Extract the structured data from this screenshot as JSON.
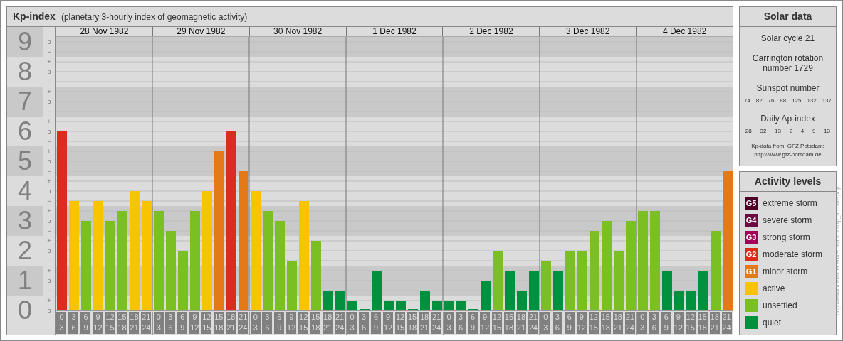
{
  "chart": {
    "title": "Kp-index",
    "subtitle": "(planetary 3-hourly index of geomagnetic activity)",
    "days": [
      "28 Nov 1982",
      "29 Nov 1982",
      "30 Nov 1982",
      "1 Dec 1982",
      "2 Dec 1982",
      "3 Dec 1982",
      "4 Dec 1982"
    ],
    "kp_marks": [
      "o",
      "−",
      "+",
      "o",
      "−",
      "+",
      "o",
      "−",
      "+",
      "o",
      "−",
      "+",
      "o",
      "−",
      "+",
      "o",
      "−",
      "+",
      "o",
      "−",
      "+",
      "o",
      "−",
      "+",
      "o",
      "−",
      "+",
      "o"
    ],
    "chart_data": {
      "type": "bar",
      "ylim": [
        0,
        9
      ],
      "yticks": [
        0,
        1,
        2,
        3,
        4,
        5,
        6,
        7,
        8,
        9
      ],
      "grid": true,
      "bands": [
        {
          "axis": "y",
          "from": 0.5,
          "to": 1.5
        },
        {
          "axis": "y",
          "from": 2.5,
          "to": 3.5
        },
        {
          "axis": "y",
          "from": 4.5,
          "to": 5.5
        },
        {
          "axis": "y",
          "from": 6.5,
          "to": 7.5
        },
        {
          "axis": "y",
          "from": 8.5,
          "to": 9.17
        }
      ],
      "categories": [
        "0\n3",
        "3\n6",
        "6\n9",
        "9\n12",
        "12\n15",
        "15\n18",
        "18\n21",
        "21\n24",
        "0\n3",
        "3\n6",
        "6\n9",
        "9\n12",
        "12\n15",
        "15\n18",
        "18\n21",
        "21\n24",
        "0\n3",
        "3\n6",
        "6\n9",
        "9\n12",
        "12\n15",
        "15\n18",
        "18\n21",
        "21\n24",
        "0\n3",
        "3\n6",
        "6\n9",
        "9\n12",
        "12\n15",
        "15\n18",
        "18\n21",
        "21\n24",
        "0\n3",
        "3\n6",
        "6\n9",
        "9\n12",
        "12\n15",
        "15\n18",
        "18\n21",
        "21\n24",
        "0\n3",
        "3\n6",
        "6\n9",
        "9\n12",
        "12\n15",
        "15\n18",
        "18\n21",
        "21\n24",
        "0\n3",
        "3\n6",
        "6\n9",
        "9\n12",
        "12\n15",
        "15\n18",
        "18\n21",
        "21\n24"
      ],
      "values": [
        6,
        3.67,
        3,
        3.67,
        3,
        3.33,
        4,
        3.67,
        3.33,
        2.67,
        2,
        3.33,
        4,
        5.33,
        6,
        4.67,
        4,
        3.33,
        3,
        1.67,
        3.67,
        2.33,
        0.67,
        0.67,
        0.33,
        0,
        1.33,
        0.33,
        0.33,
        0,
        0.67,
        0.33,
        0.33,
        0.33,
        0,
        1,
        2,
        1.33,
        0.67,
        1.33,
        1.67,
        1.33,
        2,
        2,
        2.67,
        3,
        2,
        3,
        3.33,
        3.33,
        1.33,
        0.67,
        0.67,
        1.33,
        2.67,
        4.67
      ]
    }
  },
  "solar_data": {
    "title": "Solar data",
    "cycle": "Solar cycle 21",
    "carrington": "Carrington rotation number 1729",
    "sunspot_label": "Sunspot number",
    "sunspot_numbers": [
      "74",
      "82",
      "76",
      "88",
      "125",
      "132",
      "137"
    ],
    "ap_label": "Daily Ap-index",
    "ap_values": [
      "28",
      "32",
      "13",
      "2",
      "4",
      "9",
      "13"
    ],
    "source": "Kp-data from  GFZ Potsdam:",
    "source_url": "http://www.gfz-potsdam.de"
  },
  "activity_levels": {
    "title": "Activity levels",
    "items": [
      {
        "badge": "G5",
        "label": "extreme storm",
        "color": "#4d0026"
      },
      {
        "badge": "G4",
        "label": "severe storm",
        "color": "#6b0a3e"
      },
      {
        "badge": "G3",
        "label": "strong storm",
        "color": "#a0005a"
      },
      {
        "badge": "G2",
        "label": "moderate storm",
        "color": "#d92d1e"
      },
      {
        "badge": "G1",
        "label": "minor storm",
        "color": "#e47a17"
      },
      {
        "label": "active",
        "color": "#f8c400"
      },
      {
        "label": "unsettled",
        "color": "#7ac022"
      },
      {
        "label": "quiet",
        "color": "#00913f"
      }
    ]
  },
  "credit_url": "http://www.fheusner.eu/terra/aurora/kp_archive.php"
}
